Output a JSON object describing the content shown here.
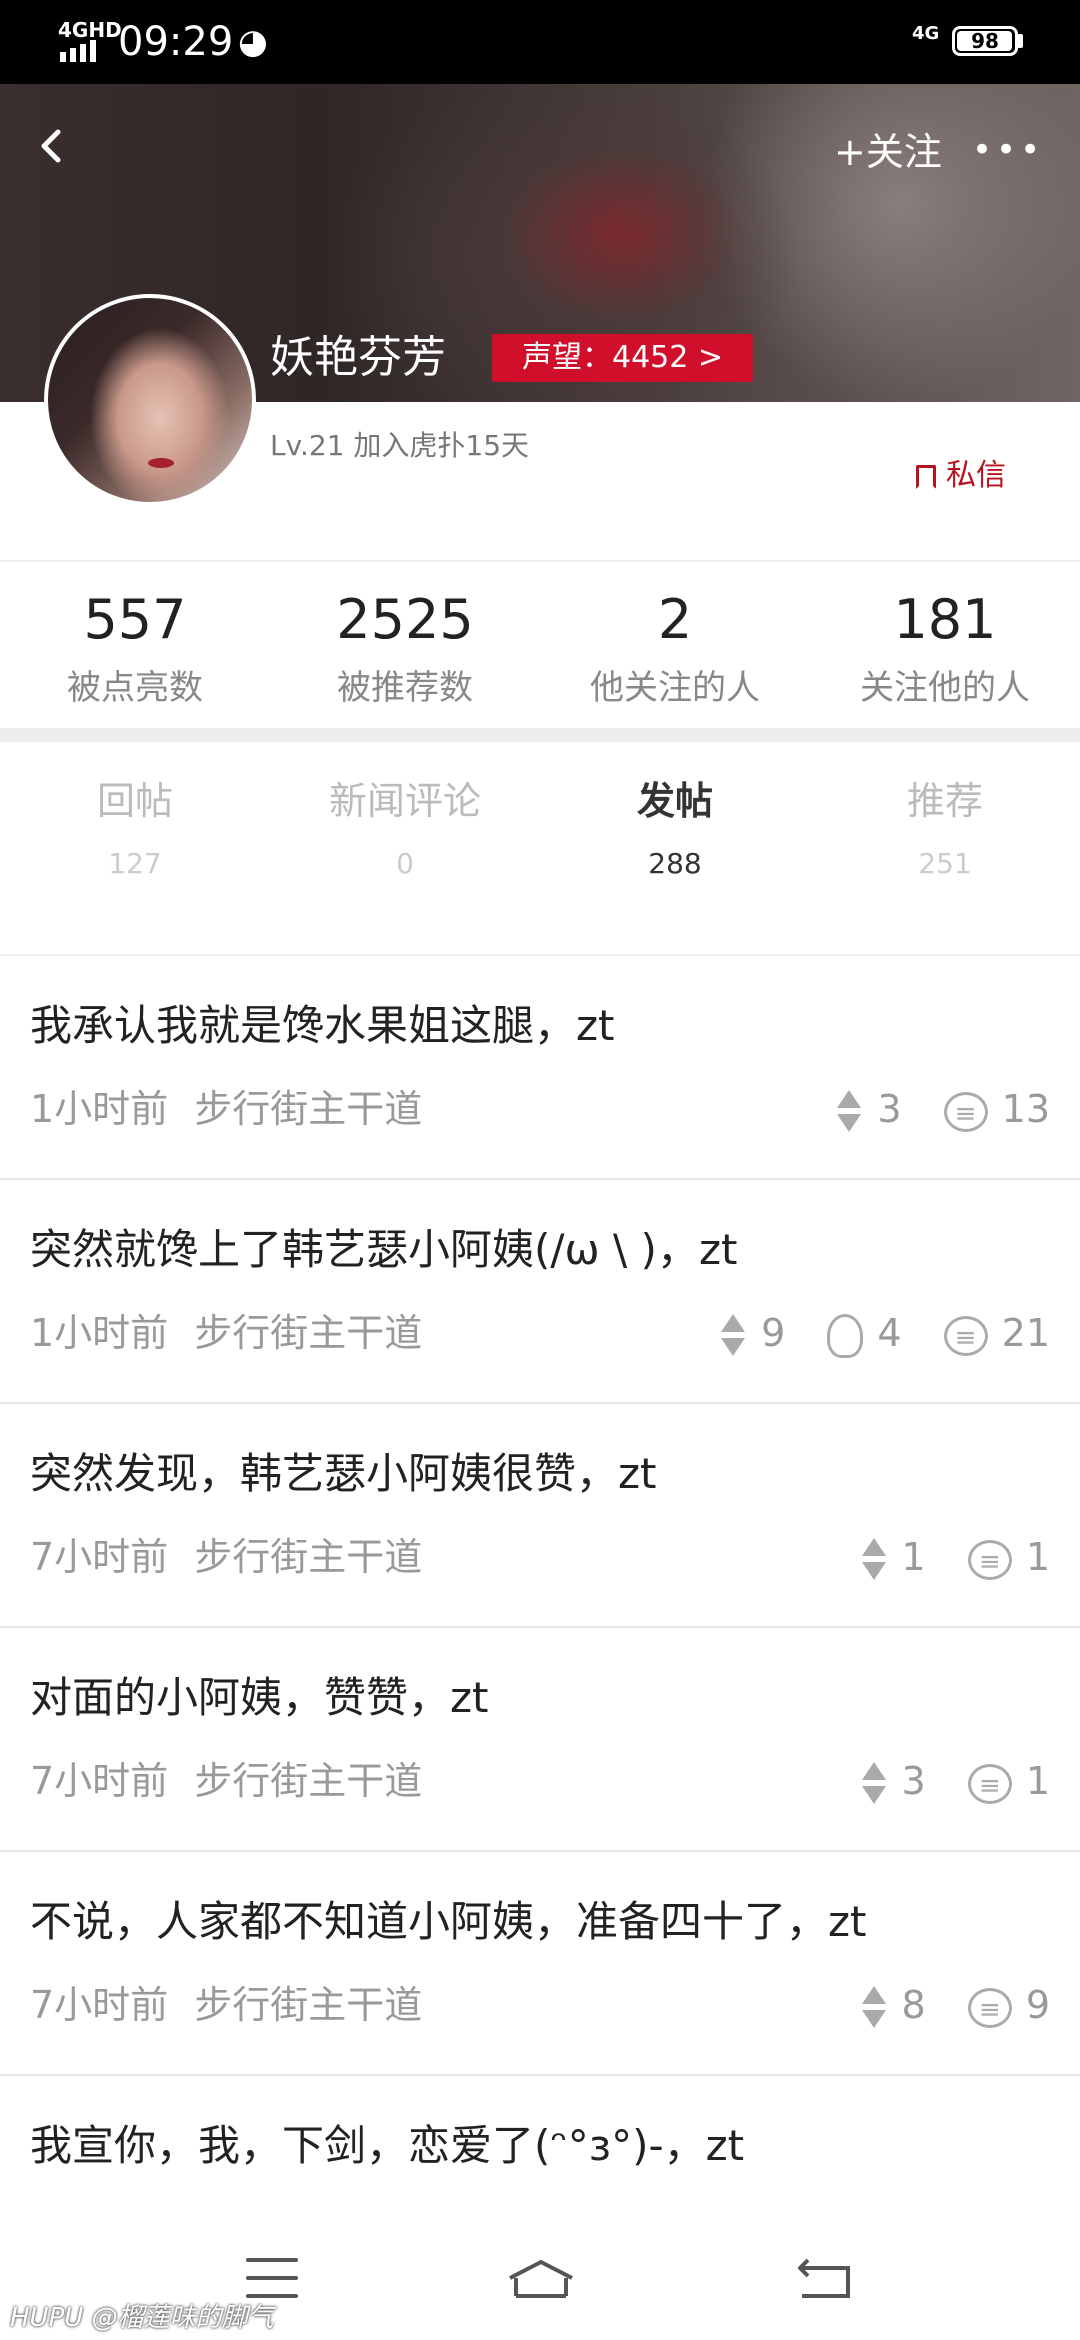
{
  "status_bar": {
    "network": "4GHD",
    "time": "09:29",
    "wechat_icon": "wechat-icon",
    "mobile_data": "4G",
    "battery": "98",
    "battery_level": 0.98
  },
  "header": {
    "follow_label": "+关注",
    "more_label": "•••",
    "username": "妖艳芬芳",
    "reputation": "声望：4452 >",
    "level": "Lv.21  加入虎扑15天",
    "dm_label": "私信"
  },
  "stats": [
    {
      "value": "557",
      "label": "被点亮数"
    },
    {
      "value": "2525",
      "label": "被推荐数"
    },
    {
      "value": "2",
      "label": "他关注的人"
    },
    {
      "value": "181",
      "label": "关注他的人"
    }
  ],
  "tabs": [
    {
      "label": "回帖",
      "count": "127",
      "active": false
    },
    {
      "label": "新闻评论",
      "count": "0",
      "active": false
    },
    {
      "label": "发帖",
      "count": "288",
      "active": true
    },
    {
      "label": "推荐",
      "count": "251",
      "active": false
    }
  ],
  "posts": [
    {
      "title": "我承认我就是馋水果姐这腿，zt",
      "time": "1小时前",
      "board": "步行街主干道",
      "recommend": "3",
      "light": null,
      "comments": "13"
    },
    {
      "title": "突然就馋上了韩艺瑟小阿姨(/ω \\ )，zt",
      "time": "1小时前",
      "board": "步行街主干道",
      "recommend": "9",
      "light": "4",
      "comments": "21"
    },
    {
      "title": "突然发现，韩艺瑟小阿姨很赞，zt",
      "time": "7小时前",
      "board": "步行街主干道",
      "recommend": "1",
      "light": null,
      "comments": "1"
    },
    {
      "title": "对面的小阿姨，赞赞，zt",
      "time": "7小时前",
      "board": "步行街主干道",
      "recommend": "3",
      "light": null,
      "comments": "1"
    },
    {
      "title": "不说，人家都不知道小阿姨，准备四十了，zt",
      "time": "7小时前",
      "board": "步行街主干道",
      "recommend": "8",
      "light": null,
      "comments": "9"
    },
    {
      "title": "我宣你，我，下剑，恋爱了(ᵔ°з°)-，zt"
    }
  ],
  "watermark": "HUPU @榴莲味的脚气",
  "colors": {
    "accent": "#d0102a",
    "dm": "#b5131f"
  }
}
